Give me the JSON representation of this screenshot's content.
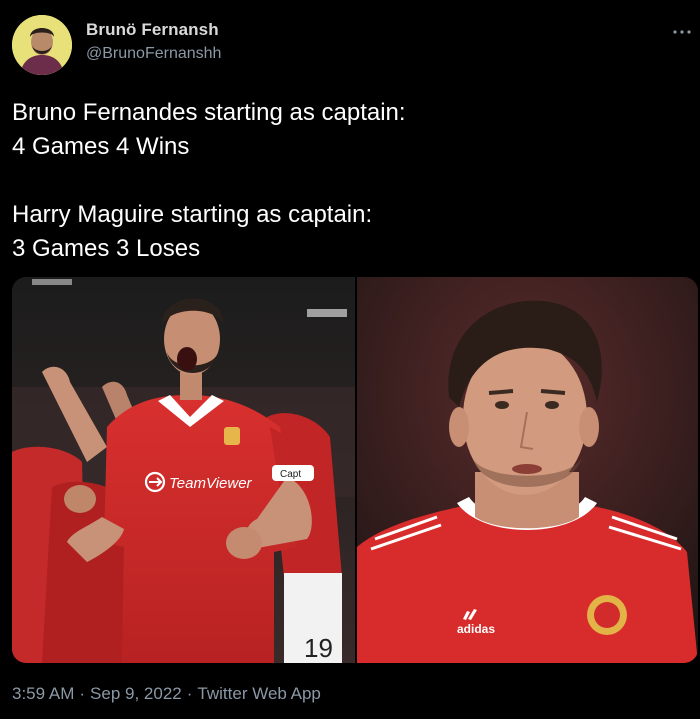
{
  "author": {
    "display_name": "Brunö Fernansh",
    "handle": "@BrunoFernanshh",
    "avatar_bg": "#e8e079"
  },
  "tweet": {
    "lines": [
      "Bruno Fernandes starting as captain:",
      "4 Games 4 Wins",
      "",
      "Harry Maguire starting as captain:",
      "3 Games 3 Loses"
    ]
  },
  "media": {
    "left_photo": {
      "shirt_sponsor": "TeamViewer",
      "armband": "Capt",
      "shorts_number": "19"
    },
    "right_photo": {
      "brand": "adidas"
    }
  },
  "footer": {
    "time": "3:59 AM",
    "date": "Sep 9, 2022",
    "source": "Twitter Web App",
    "separator": "·"
  },
  "colors": {
    "background": "#000000",
    "text": "#ffffff",
    "secondary": "#8b98a5",
    "jersey_red": "#d42a2a"
  },
  "icons": {
    "more": "more-horizontal-icon"
  }
}
